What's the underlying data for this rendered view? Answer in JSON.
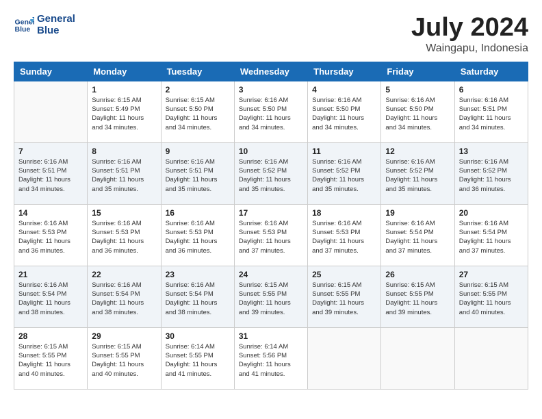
{
  "header": {
    "logo_line1": "General",
    "logo_line2": "Blue",
    "month_year": "July 2024",
    "location": "Waingapu, Indonesia"
  },
  "days_of_week": [
    "Sunday",
    "Monday",
    "Tuesday",
    "Wednesday",
    "Thursday",
    "Friday",
    "Saturday"
  ],
  "weeks": [
    [
      {
        "day": "",
        "info": ""
      },
      {
        "day": "1",
        "info": "Sunrise: 6:15 AM\nSunset: 5:49 PM\nDaylight: 11 hours\nand 34 minutes."
      },
      {
        "day": "2",
        "info": "Sunrise: 6:15 AM\nSunset: 5:50 PM\nDaylight: 11 hours\nand 34 minutes."
      },
      {
        "day": "3",
        "info": "Sunrise: 6:16 AM\nSunset: 5:50 PM\nDaylight: 11 hours\nand 34 minutes."
      },
      {
        "day": "4",
        "info": "Sunrise: 6:16 AM\nSunset: 5:50 PM\nDaylight: 11 hours\nand 34 minutes."
      },
      {
        "day": "5",
        "info": "Sunrise: 6:16 AM\nSunset: 5:50 PM\nDaylight: 11 hours\nand 34 minutes."
      },
      {
        "day": "6",
        "info": "Sunrise: 6:16 AM\nSunset: 5:51 PM\nDaylight: 11 hours\nand 34 minutes."
      }
    ],
    [
      {
        "day": "7",
        "info": "Sunrise: 6:16 AM\nSunset: 5:51 PM\nDaylight: 11 hours\nand 34 minutes."
      },
      {
        "day": "8",
        "info": "Sunrise: 6:16 AM\nSunset: 5:51 PM\nDaylight: 11 hours\nand 35 minutes."
      },
      {
        "day": "9",
        "info": "Sunrise: 6:16 AM\nSunset: 5:51 PM\nDaylight: 11 hours\nand 35 minutes."
      },
      {
        "day": "10",
        "info": "Sunrise: 6:16 AM\nSunset: 5:52 PM\nDaylight: 11 hours\nand 35 minutes."
      },
      {
        "day": "11",
        "info": "Sunrise: 6:16 AM\nSunset: 5:52 PM\nDaylight: 11 hours\nand 35 minutes."
      },
      {
        "day": "12",
        "info": "Sunrise: 6:16 AM\nSunset: 5:52 PM\nDaylight: 11 hours\nand 35 minutes."
      },
      {
        "day": "13",
        "info": "Sunrise: 6:16 AM\nSunset: 5:52 PM\nDaylight: 11 hours\nand 36 minutes."
      }
    ],
    [
      {
        "day": "14",
        "info": "Sunrise: 6:16 AM\nSunset: 5:53 PM\nDaylight: 11 hours\nand 36 minutes."
      },
      {
        "day": "15",
        "info": "Sunrise: 6:16 AM\nSunset: 5:53 PM\nDaylight: 11 hours\nand 36 minutes."
      },
      {
        "day": "16",
        "info": "Sunrise: 6:16 AM\nSunset: 5:53 PM\nDaylight: 11 hours\nand 36 minutes."
      },
      {
        "day": "17",
        "info": "Sunrise: 6:16 AM\nSunset: 5:53 PM\nDaylight: 11 hours\nand 37 minutes."
      },
      {
        "day": "18",
        "info": "Sunrise: 6:16 AM\nSunset: 5:53 PM\nDaylight: 11 hours\nand 37 minutes."
      },
      {
        "day": "19",
        "info": "Sunrise: 6:16 AM\nSunset: 5:54 PM\nDaylight: 11 hours\nand 37 minutes."
      },
      {
        "day": "20",
        "info": "Sunrise: 6:16 AM\nSunset: 5:54 PM\nDaylight: 11 hours\nand 37 minutes."
      }
    ],
    [
      {
        "day": "21",
        "info": "Sunrise: 6:16 AM\nSunset: 5:54 PM\nDaylight: 11 hours\nand 38 minutes."
      },
      {
        "day": "22",
        "info": "Sunrise: 6:16 AM\nSunset: 5:54 PM\nDaylight: 11 hours\nand 38 minutes."
      },
      {
        "day": "23",
        "info": "Sunrise: 6:16 AM\nSunset: 5:54 PM\nDaylight: 11 hours\nand 38 minutes."
      },
      {
        "day": "24",
        "info": "Sunrise: 6:15 AM\nSunset: 5:55 PM\nDaylight: 11 hours\nand 39 minutes."
      },
      {
        "day": "25",
        "info": "Sunrise: 6:15 AM\nSunset: 5:55 PM\nDaylight: 11 hours\nand 39 minutes."
      },
      {
        "day": "26",
        "info": "Sunrise: 6:15 AM\nSunset: 5:55 PM\nDaylight: 11 hours\nand 39 minutes."
      },
      {
        "day": "27",
        "info": "Sunrise: 6:15 AM\nSunset: 5:55 PM\nDaylight: 11 hours\nand 40 minutes."
      }
    ],
    [
      {
        "day": "28",
        "info": "Sunrise: 6:15 AM\nSunset: 5:55 PM\nDaylight: 11 hours\nand 40 minutes."
      },
      {
        "day": "29",
        "info": "Sunrise: 6:15 AM\nSunset: 5:55 PM\nDaylight: 11 hours\nand 40 minutes."
      },
      {
        "day": "30",
        "info": "Sunrise: 6:14 AM\nSunset: 5:55 PM\nDaylight: 11 hours\nand 41 minutes."
      },
      {
        "day": "31",
        "info": "Sunrise: 6:14 AM\nSunset: 5:56 PM\nDaylight: 11 hours\nand 41 minutes."
      },
      {
        "day": "",
        "info": ""
      },
      {
        "day": "",
        "info": ""
      },
      {
        "day": "",
        "info": ""
      }
    ]
  ]
}
